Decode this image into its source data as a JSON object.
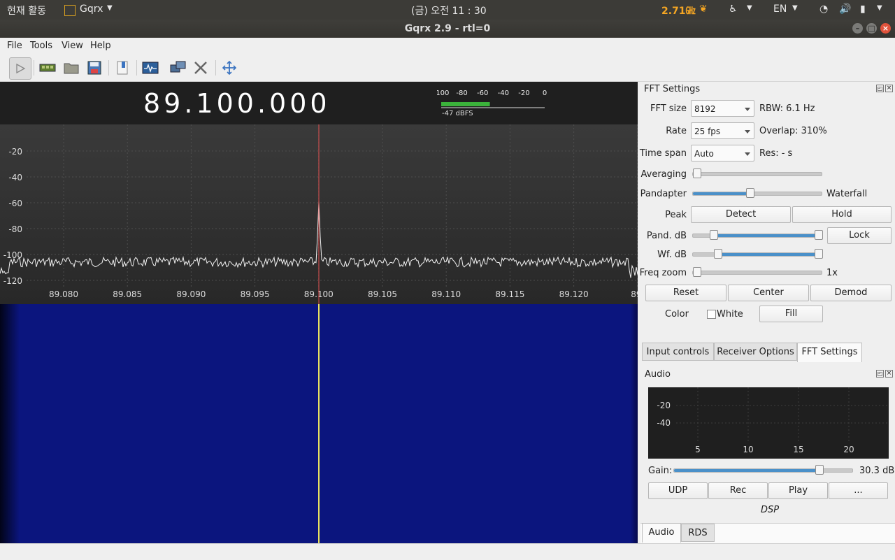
{
  "topbar": {
    "activities": "현재 활동",
    "app_name": "Gqrx",
    "clock": "(금) 오전 11 : 30",
    "cpu_freq": "2.71㎓",
    "language": "EN"
  },
  "window": {
    "title": "Gqrx 2.9 - rtl=0"
  },
  "menu": {
    "file": "File",
    "tools": "Tools",
    "view": "View",
    "help": "Help"
  },
  "frequency": {
    "display": "89.100.000"
  },
  "smeter": {
    "ticks": [
      "-100",
      "-80",
      "-60",
      "-40",
      "-20",
      "0"
    ],
    "reading": "-47 dBFS",
    "level_fraction": 0.47
  },
  "plot": {
    "y_ticks": [
      "-20",
      "-40",
      "-60",
      "-80",
      "-100",
      "-120"
    ],
    "x_ticks": [
      "89.080",
      "89.085",
      "89.090",
      "89.095",
      "89.100",
      "89.105",
      "89.110",
      "89.115",
      "89.120",
      "89."
    ]
  },
  "fft": {
    "title": "FFT Settings",
    "fft_size_label": "FFT size",
    "fft_size_value": "8192",
    "rbw": "RBW: 6.1 Hz",
    "rate_label": "Rate",
    "rate_value": "25 fps",
    "overlap": "Overlap: 310%",
    "timespan_label": "Time span",
    "timespan_value": "Auto",
    "res": "Res: - s",
    "averaging_label": "Averaging",
    "pandapter_label": "Pandapter",
    "waterfall_label": "Waterfall",
    "peak_label": "Peak",
    "detect": "Detect",
    "hold": "Hold",
    "pand_db_label": "Pand. dB",
    "lock": "Lock",
    "wf_db_label": "Wf. dB",
    "freq_zoom_label": "Freq zoom",
    "zoom_value": "1x",
    "reset": "Reset",
    "center": "Center",
    "demod": "Demod",
    "color_label": "Color",
    "white_label": "White",
    "fill": "Fill",
    "averaging_level": 0.0,
    "pandapter_level": 0.44,
    "zoom_level": 0.0
  },
  "tabs": {
    "input": "Input controls",
    "receiver": "Receiver Options",
    "fft": "FFT Settings"
  },
  "audio": {
    "title": "Audio",
    "y_ticks": [
      "-20",
      "-40"
    ],
    "x_ticks": [
      "5",
      "10",
      "15",
      "20"
    ],
    "gain_label": "Gain:",
    "gain_value": "30.3 dB",
    "udp": "UDP",
    "rec": "Rec",
    "play": "Play",
    "more": "...",
    "dsp": "DSP",
    "gain_level": 0.83
  },
  "bottom_tabs": {
    "audio": "Audio",
    "rds": "RDS"
  },
  "colors": {
    "accent": "#4a90c9",
    "waterfall": "#0b157e",
    "marker": "#e8e060"
  }
}
